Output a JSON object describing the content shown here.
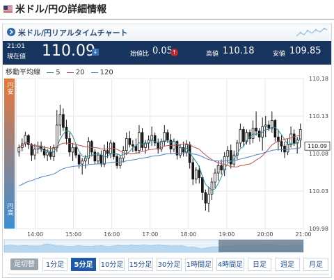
{
  "page": {
    "title": "米ドル/円の詳細情報"
  },
  "panel": {
    "title": "米ドル/円リアルタイムチャート"
  },
  "quote": {
    "time": "21:01",
    "caption": "現在値",
    "price": "110.09",
    "change_label": "始値比",
    "change": "0.05",
    "high_label": "高値",
    "high": "110.18",
    "low_label": "安値",
    "low": "109.85",
    "direction": "down"
  },
  "legend": {
    "title": "移動平均線",
    "items": [
      {
        "label": "5",
        "color": "#2e8b9a"
      },
      {
        "label": "20",
        "color": "#c0504d"
      },
      {
        "label": "120",
        "color": "#4f81bd"
      }
    ]
  },
  "colors": {
    "header_bar": "#17355e",
    "yen_weak": "#e8773a",
    "yen_strong": "#3d8fd6",
    "active_button": "#1f5aa6",
    "candle_up": "#ffffff",
    "candle_down": "#1a1a1a"
  },
  "chart_data": {
    "type": "candlestick",
    "title": "",
    "xlabel": "",
    "ylabel": "",
    "ylim": [
      109.98,
      110.18
    ],
    "yticks": [
      "110.18",
      "110.13",
      "110.08",
      "110.03",
      "109.98"
    ],
    "xticks": [
      "14:00",
      "15:00",
      "16:00",
      "17:00",
      "18:00",
      "19:00",
      "20:00",
      "21:00"
    ],
    "x_start": "13:30",
    "x_end": "21:00",
    "bar_minutes": 5,
    "current_price_label": "110.09",
    "y_side_top": "円安",
    "y_side_bottom": "円高",
    "grid": true,
    "ohlc": [
      [
        110.082,
        110.092,
        110.076,
        110.088
      ],
      [
        110.088,
        110.1,
        110.083,
        110.093
      ],
      [
        110.093,
        110.109,
        110.089,
        110.104
      ],
      [
        110.104,
        110.106,
        110.086,
        110.092
      ],
      [
        110.092,
        110.094,
        110.07,
        110.078
      ],
      [
        110.078,
        110.093,
        110.072,
        110.086
      ],
      [
        110.086,
        110.096,
        110.08,
        110.09
      ],
      [
        110.09,
        110.096,
        110.082,
        110.086
      ],
      [
        110.086,
        110.09,
        110.074,
        110.078
      ],
      [
        110.078,
        110.086,
        110.07,
        110.082
      ],
      [
        110.082,
        110.09,
        110.072,
        110.076
      ],
      [
        110.076,
        110.092,
        110.07,
        110.088
      ],
      [
        110.088,
        110.138,
        110.082,
        110.118
      ],
      [
        110.118,
        110.145,
        110.104,
        110.132
      ],
      [
        110.132,
        110.14,
        110.11,
        110.115
      ],
      [
        110.115,
        110.125,
        110.092,
        110.1
      ],
      [
        110.1,
        110.108,
        110.076,
        110.082
      ],
      [
        110.082,
        110.094,
        110.07,
        110.088
      ],
      [
        110.088,
        110.092,
        110.074,
        110.078
      ],
      [
        110.078,
        110.08,
        110.06,
        110.066
      ],
      [
        110.066,
        110.074,
        110.052,
        110.07
      ],
      [
        110.07,
        110.078,
        110.06,
        110.074
      ],
      [
        110.074,
        110.102,
        110.066,
        110.096
      ],
      [
        110.096,
        110.098,
        110.076,
        110.082
      ],
      [
        110.082,
        110.086,
        110.066,
        110.07
      ],
      [
        110.07,
        110.082,
        110.066,
        110.078
      ],
      [
        110.078,
        110.084,
        110.062,
        110.066
      ],
      [
        110.066,
        110.092,
        110.062,
        110.084
      ],
      [
        110.084,
        110.096,
        110.074,
        110.08
      ],
      [
        110.08,
        110.098,
        110.074,
        110.094
      ],
      [
        110.094,
        110.096,
        110.072,
        110.076
      ],
      [
        110.076,
        110.08,
        110.06,
        110.064
      ],
      [
        110.064,
        110.078,
        110.06,
        110.074
      ],
      [
        110.074,
        110.09,
        110.068,
        110.084
      ],
      [
        110.084,
        110.108,
        110.078,
        110.1
      ],
      [
        110.1,
        110.11,
        110.088,
        110.092
      ],
      [
        110.092,
        110.098,
        110.082,
        110.09
      ],
      [
        110.09,
        110.1,
        110.08,
        110.084
      ],
      [
        110.084,
        110.118,
        110.08,
        110.108
      ],
      [
        110.108,
        110.114,
        110.084,
        110.088
      ],
      [
        110.088,
        110.098,
        110.08,
        110.094
      ],
      [
        110.094,
        110.104,
        110.086,
        110.098
      ],
      [
        110.098,
        110.116,
        110.09,
        110.104
      ],
      [
        110.104,
        110.108,
        110.09,
        110.094
      ],
      [
        110.094,
        110.1,
        110.08,
        110.086
      ],
      [
        110.086,
        110.1,
        110.082,
        110.096
      ],
      [
        110.096,
        110.118,
        110.09,
        110.108
      ],
      [
        110.108,
        110.112,
        110.094,
        110.098
      ],
      [
        110.098,
        110.106,
        110.08,
        110.086
      ],
      [
        110.086,
        110.1,
        110.082,
        110.096
      ],
      [
        110.096,
        110.098,
        110.072,
        110.078
      ],
      [
        110.078,
        110.092,
        110.074,
        110.088
      ],
      [
        110.088,
        110.096,
        110.076,
        110.082
      ],
      [
        110.082,
        110.098,
        110.076,
        110.092
      ],
      [
        110.092,
        110.096,
        110.06,
        110.068
      ],
      [
        110.068,
        110.074,
        110.038,
        110.046
      ],
      [
        110.046,
        110.062,
        110.04,
        110.058
      ],
      [
        110.058,
        110.064,
        110.04,
        110.048
      ],
      [
        110.048,
        110.05,
        110.018,
        110.028
      ],
      [
        110.028,
        110.032,
        110.004,
        110.014
      ],
      [
        110.014,
        110.036,
        110.002,
        110.026
      ],
      [
        110.026,
        110.048,
        110.018,
        110.042
      ],
      [
        110.042,
        110.06,
        110.034,
        110.054
      ],
      [
        110.054,
        110.07,
        110.044,
        110.064
      ],
      [
        110.064,
        110.072,
        110.052,
        110.058
      ],
      [
        110.058,
        110.082,
        110.05,
        110.076
      ],
      [
        110.076,
        110.09,
        110.068,
        110.084
      ],
      [
        110.084,
        110.092,
        110.06,
        110.066
      ],
      [
        110.066,
        110.084,
        110.062,
        110.078
      ],
      [
        110.078,
        110.098,
        110.072,
        110.094
      ],
      [
        110.094,
        110.12,
        110.088,
        110.112
      ],
      [
        110.112,
        110.116,
        110.09,
        110.096
      ],
      [
        110.096,
        110.112,
        110.092,
        110.108
      ],
      [
        110.108,
        110.112,
        110.092,
        110.1
      ],
      [
        110.1,
        110.124,
        110.094,
        110.114
      ],
      [
        110.114,
        110.136,
        110.104,
        110.11
      ],
      [
        110.11,
        110.114,
        110.096,
        110.102
      ],
      [
        110.102,
        110.128,
        110.084,
        110.116
      ],
      [
        110.116,
        110.13,
        110.102,
        110.118
      ],
      [
        110.118,
        110.124,
        110.11,
        110.114
      ],
      [
        110.114,
        110.136,
        110.108,
        110.124
      ],
      [
        110.124,
        110.126,
        110.096,
        110.102
      ],
      [
        110.102,
        110.112,
        110.084,
        110.096
      ],
      [
        110.096,
        110.104,
        110.082,
        110.09
      ],
      [
        110.09,
        110.096,
        110.074,
        110.082
      ],
      [
        110.082,
        110.1,
        110.078,
        110.092
      ],
      [
        110.092,
        110.116,
        110.088,
        110.106
      ],
      [
        110.106,
        110.112,
        110.09,
        110.094
      ],
      [
        110.094,
        110.102,
        110.08,
        110.098
      ],
      [
        110.098,
        110.12,
        110.088,
        110.112
      ]
    ]
  },
  "timeframes": {
    "label": "足切替",
    "buttons": [
      "1分足",
      "5分足",
      "10分足",
      "15分足",
      "30分足",
      "1時間足",
      "4時間足",
      "日足",
      "週足",
      "月足"
    ],
    "active": "5分足"
  }
}
